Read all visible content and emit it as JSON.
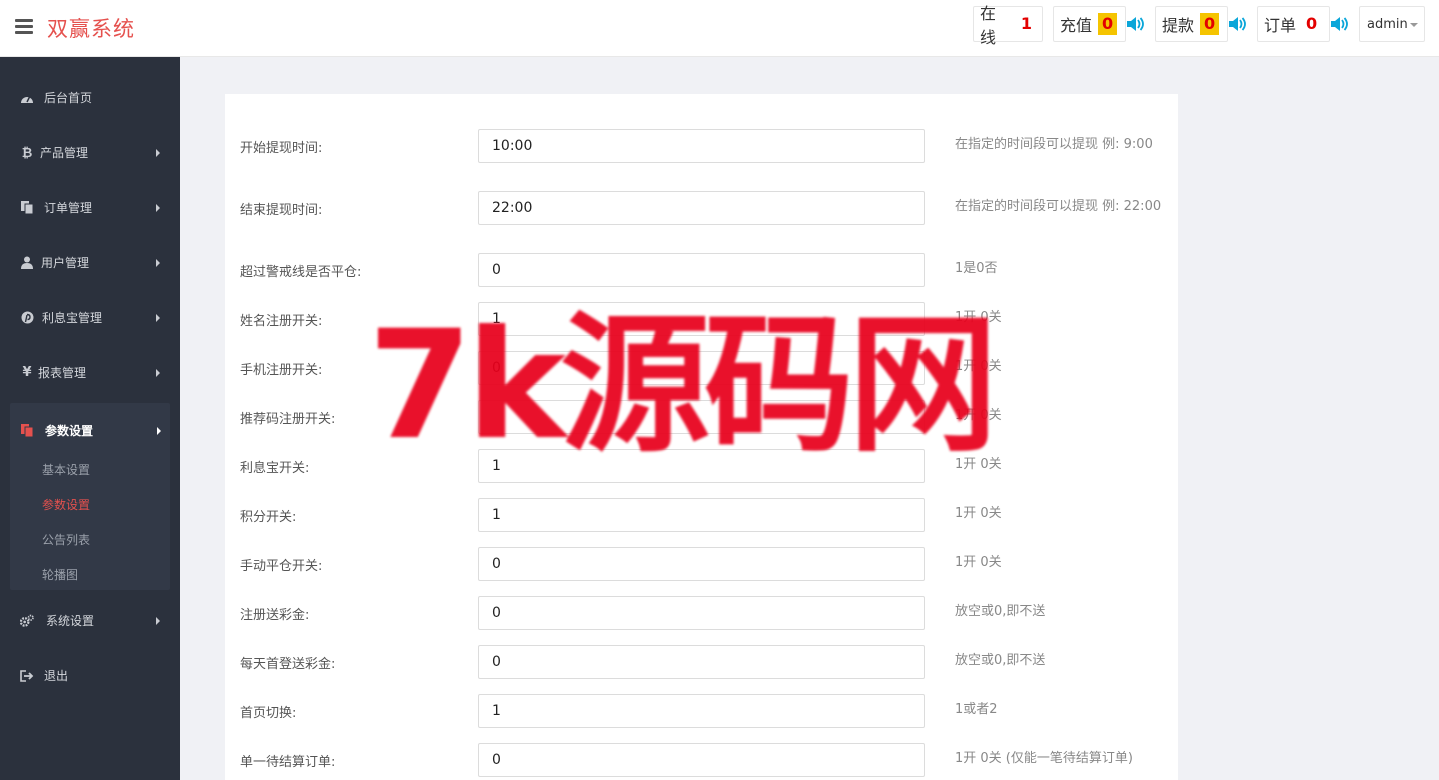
{
  "header": {
    "brand": "双赢系统",
    "stats": [
      {
        "label": "在线",
        "count": "1"
      },
      {
        "label": "充值",
        "count": "0"
      },
      {
        "label": "提款",
        "count": "0"
      },
      {
        "label": "订单",
        "count": "0"
      }
    ],
    "user": "admin"
  },
  "sidebar": {
    "items": [
      {
        "label": "后台首页",
        "icon": "dashboard-icon"
      },
      {
        "label": "产品管理",
        "icon": "bitcoin-icon"
      },
      {
        "label": "订单管理",
        "icon": "copy-icon"
      },
      {
        "label": "用户管理",
        "icon": "user-icon"
      },
      {
        "label": "利息宝管理",
        "icon": "pinterest-icon"
      },
      {
        "label": "报表管理",
        "icon": "yen-icon"
      },
      {
        "label": "参数设置",
        "icon": "file-icon"
      },
      {
        "label": "系统设置",
        "icon": "cogs-icon"
      },
      {
        "label": "退出",
        "icon": "sign-out-icon"
      }
    ],
    "subitems": [
      "基本设置",
      "参数设置",
      "公告列表",
      "轮播图"
    ]
  },
  "form": {
    "rows": [
      {
        "label": "开始提现时间:",
        "value": "10:00",
        "hint": "在指定的时间段可以提现 例: 9:00"
      },
      {
        "label": "结束提现时间:",
        "value": "22:00",
        "hint": "在指定的时间段可以提现 例: 22:00"
      },
      {
        "label": "超过警戒线是否平仓:",
        "value": "0",
        "hint": "1是0否"
      },
      {
        "label": "姓名注册开关:",
        "value": "1",
        "hint": "1开 0关"
      },
      {
        "label": "手机注册开关:",
        "value": "0",
        "hint": "1开 0关"
      },
      {
        "label": "推荐码注册开关:",
        "value": "",
        "hint": "1开 0关"
      },
      {
        "label": "利息宝开关:",
        "value": "1",
        "hint": "1开 0关"
      },
      {
        "label": "积分开关:",
        "value": "1",
        "hint": "1开 0关"
      },
      {
        "label": "手动平仓开关:",
        "value": "0",
        "hint": "1开 0关"
      },
      {
        "label": "注册送彩金:",
        "value": "0",
        "hint": "放空或0,即不送"
      },
      {
        "label": "每天首登送彩金:",
        "value": "0",
        "hint": "放空或0,即不送"
      },
      {
        "label": "首页切换:",
        "value": "1",
        "hint": "1或者2"
      },
      {
        "label": "单一待结算订单:",
        "value": "0",
        "hint": "1开 0关 (仅能一笔待结算订单)"
      }
    ]
  },
  "watermark": "7k源码网",
  "colors": {
    "accent": "#e5514e",
    "sidebar": "#2b313d",
    "badge": "#f5c400",
    "speaker": "#0aa6d9",
    "watermark": "#e8001c"
  }
}
